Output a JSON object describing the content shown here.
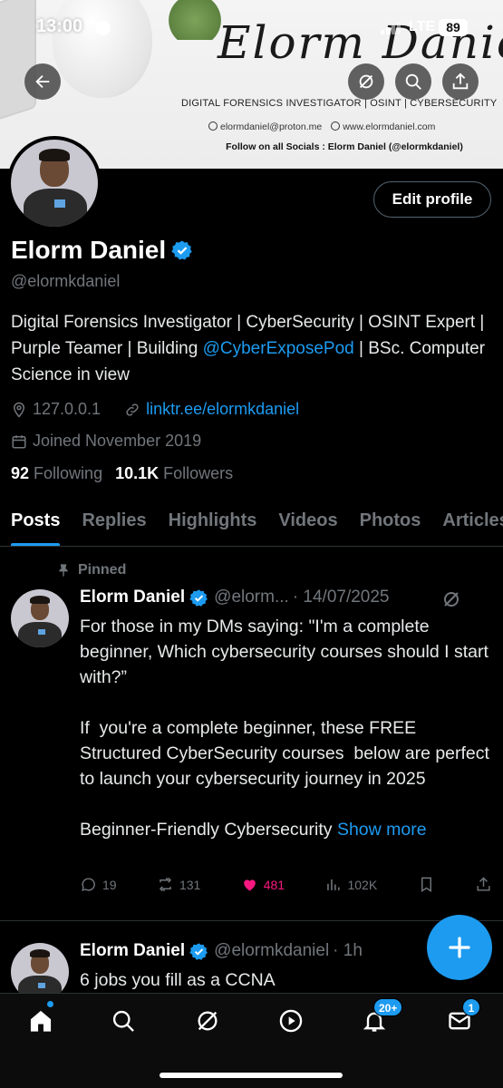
{
  "status_bar": {
    "time": "13:00",
    "network": "LTE",
    "battery": "89"
  },
  "banner": {
    "script_name": "Elorm Daniel",
    "subtitle": "DIGITAL FORENSICS INVESTIGATOR | OSINT | CYBERSECURITY",
    "email": "elormdaniel@proton.me",
    "website": "www.elormdaniel.com",
    "follow": "Follow on all Socials : Elorm Daniel (@elormkdaniel)"
  },
  "header": {
    "back_icon": "arrow-left-icon",
    "grok_icon": "grok-icon",
    "search_icon": "search-icon",
    "share_icon": "share-icon"
  },
  "profile": {
    "name": "Elorm Daniel",
    "handle": "@elormkdaniel",
    "edit_label": "Edit profile",
    "bio_part1": "Digital Forensics Investigator | CyberSecurity | OSINT Expert | Purple Teamer | Building ",
    "bio_link": "@CyberExposePod",
    "bio_part2": " | BSc. Computer Science in view",
    "location": "127.0.0.1",
    "website": "linktr.ee/elormkdaniel",
    "joined": "Joined November 2019",
    "following_count": "92",
    "following_label": "Following",
    "followers_count": "10.1K",
    "followers_label": "Followers"
  },
  "tabs": [
    {
      "label": "Posts",
      "active": true
    },
    {
      "label": "Replies"
    },
    {
      "label": "Highlights"
    },
    {
      "label": "Videos"
    },
    {
      "label": "Photos"
    },
    {
      "label": "Articles"
    }
  ],
  "posts": [
    {
      "pinned_label": "Pinned",
      "name": "Elorm Daniel",
      "handle": "@elorm...",
      "date": "· 14/07/2025",
      "text": "For those in my DMs saying: \"I'm a complete beginner, Which cybersecurity courses should I start with?”\n\nIf  you're a complete beginner, these FREE Structured CyberSecurity courses  below are perfect to launch your cybersecurity journey in 2025\n\nBeginner-Friendly Cybersecurity ",
      "show_more": "Show more",
      "replies": "19",
      "reposts": "131",
      "likes": "481",
      "views": "102K"
    },
    {
      "name": "Elorm Daniel",
      "handle": "@elormkdaniel",
      "date": "· 1h",
      "text": "6 jobs you fill as a CCNA"
    }
  ],
  "bottom_nav": {
    "notifications_badge": "20+",
    "messages_badge": "1"
  },
  "colors": {
    "accent": "#1d9bf0",
    "like": "#f91880",
    "muted": "#71767b",
    "background": "#000000"
  }
}
